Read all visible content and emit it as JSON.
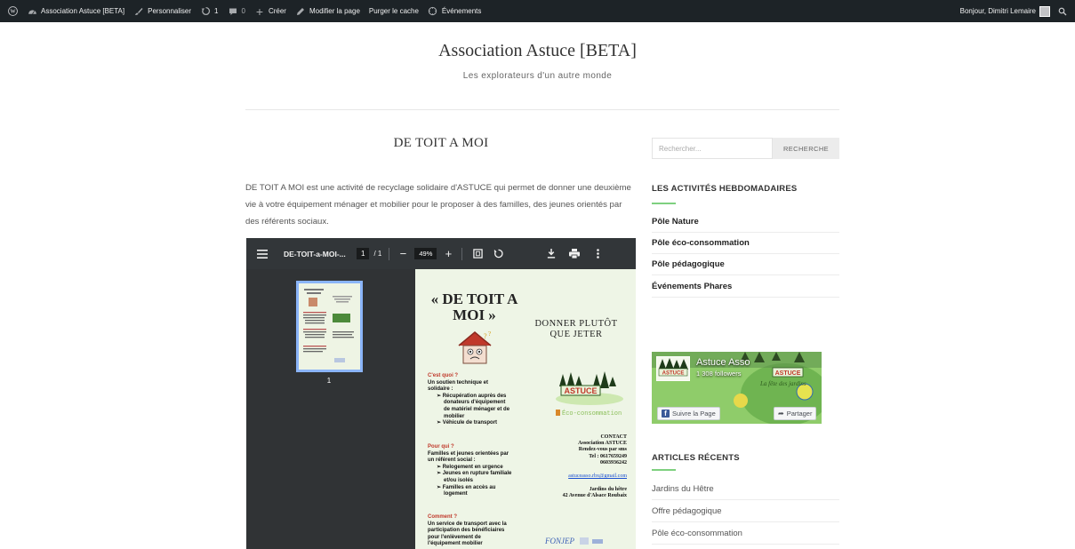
{
  "adminbar": {
    "site": "Association Astuce [BETA]",
    "customize": "Personnaliser",
    "updates_count": "1",
    "comments_count": "0",
    "new": "Créer",
    "edit": "Modifier la page",
    "purge": "Purger le cache",
    "events": "Événements",
    "greeting": "Bonjour, Dimitri Lemaire"
  },
  "header": {
    "title": "Association Astuce [BETA]",
    "description": "Les explorateurs d'un autre monde"
  },
  "post": {
    "title": "DE TOIT A MOI",
    "body": "DE TOIT A MOI est une activité de recyclage solidaire d'ASTUCE qui permet de donner une deuxième vie à votre équipement ménager et mobilier pour le proposer à des familles, des jeunes orientés par des référents sociaux."
  },
  "pdf": {
    "filename": "DE-TOIT-a-MOI-...",
    "page_current": "1",
    "page_total": "/ 1",
    "zoom": "49%",
    "thumb_label": "1",
    "page": {
      "big_title": "« DE TOIT A MOI »",
      "subtitle": "DONNER PLUTÔT QUE JETER",
      "q1": "C'est quoi ?",
      "a1_line1": "Un soutien technique et",
      "a1_line2": "solidaire :",
      "a1_b1": "➢ Récupération auprès des",
      "a1_b1b": "donateurs d'équipement",
      "a1_b1c": "de matériel ménager et  de",
      "a1_b1d": "mobilier",
      "a1_b2": "➢ Véhicule de transport",
      "q2": "Pour qui ?",
      "a2_line1": "Familles et jeunes orientées par",
      "a2_line2": "un référent social  :",
      "a2_b1": "➢ Relogement en urgence",
      "a2_b2": "➢ Jeunes en rupture familiale",
      "a2_b2b": "et/ou isolés",
      "a2_b3": "➢ Familles en accès au",
      "a2_b3b": "logement",
      "q3": "Comment ?",
      "a3_line1": "Un service de transport avec la",
      "a3_line2": "participation des bénéficiaires",
      "a3_line3": "pour l'enlèvement de",
      "a3_line4": "l'équipement mobilier",
      "eco": "Éco-consommation",
      "contact_title": "CONTACT",
      "contact_org": "Association ASTUCE",
      "contact_rdv": "Rendez-vous par sms",
      "contact_tel": "Tel : 0617659249",
      "contact_tel2": "0603936242",
      "contact_mail": "astuceasso.rbx@gmail.com",
      "contact_place": "Jardins du hêtre",
      "contact_addr": "42 Avenue d'Alsace Roubaix",
      "logo_astuce": "ASTUCE",
      "logo_fonjep": "FONJEP"
    }
  },
  "sidebar": {
    "search_placeholder": "Rechercher...",
    "search_button": "RECHERCHE",
    "activities_title": "LES ACTIVITÉS HEBDOMADAIRES",
    "activities": [
      "Pôle Nature",
      "Pôle éco-consommation",
      "Pôle pédagogique",
      "Événements Phares"
    ],
    "fb": {
      "name": "Astuce Asso",
      "followers": "1 308 followers",
      "follow": "Suivre la Page",
      "share": "Partager",
      "banner_text": "La fête des jardins"
    },
    "recent_title": "ARTICLES RÉCENTS",
    "recent": [
      "Jardins du Hêtre",
      "Offre pédagogique",
      "Pôle éco-consommation"
    ]
  },
  "colors": {
    "adminbar_bg": "#1d2327",
    "accent_green": "#7ed07f",
    "pdf_toolbar": "#323639",
    "pdf_bg": "#525659",
    "fb_blue": "#3b5998"
  }
}
